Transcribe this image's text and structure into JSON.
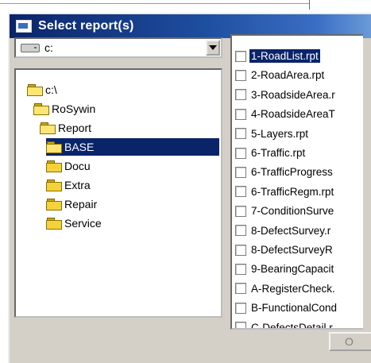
{
  "window": {
    "title": "Select report(s)"
  },
  "drive": {
    "label": "c:"
  },
  "folders": [
    {
      "label": "c:\\",
      "level": 0,
      "open": true,
      "selected": false
    },
    {
      "label": "RoSywin",
      "level": 1,
      "open": true,
      "selected": false
    },
    {
      "label": "Report",
      "level": 2,
      "open": true,
      "selected": false
    },
    {
      "label": "BASE",
      "level": 3,
      "open": true,
      "selected": true
    },
    {
      "label": "Docu",
      "level": 3,
      "open": false,
      "selected": false
    },
    {
      "label": "Extra",
      "level": 3,
      "open": false,
      "selected": false
    },
    {
      "label": "Repair",
      "level": 3,
      "open": false,
      "selected": false
    },
    {
      "label": "Service",
      "level": 3,
      "open": false,
      "selected": false
    }
  ],
  "reports": [
    {
      "label": "1-RoadList.rpt",
      "selected": true
    },
    {
      "label": "2-RoadArea.rpt",
      "selected": false
    },
    {
      "label": "3-RoadsideArea.r",
      "selected": false
    },
    {
      "label": "4-RoadsideAreaT",
      "selected": false
    },
    {
      "label": "5-Layers.rpt",
      "selected": false
    },
    {
      "label": "6-Traffic.rpt",
      "selected": false
    },
    {
      "label": "6-TrafficProgress",
      "selected": false
    },
    {
      "label": "6-TrafficRegm.rpt",
      "selected": false
    },
    {
      "label": "7-ConditionSurve",
      "selected": false
    },
    {
      "label": "8-DefectSurvey.r",
      "selected": false
    },
    {
      "label": "8-DefectSurveyR",
      "selected": false
    },
    {
      "label": "9-BearingCapacit",
      "selected": false
    },
    {
      "label": "A-RegisterCheck.",
      "selected": false
    },
    {
      "label": "B-FunctionalCond",
      "selected": false
    },
    {
      "label": "C-DefectsDetail.r",
      "selected": false
    }
  ],
  "buttons": {
    "ok_label": "O"
  }
}
